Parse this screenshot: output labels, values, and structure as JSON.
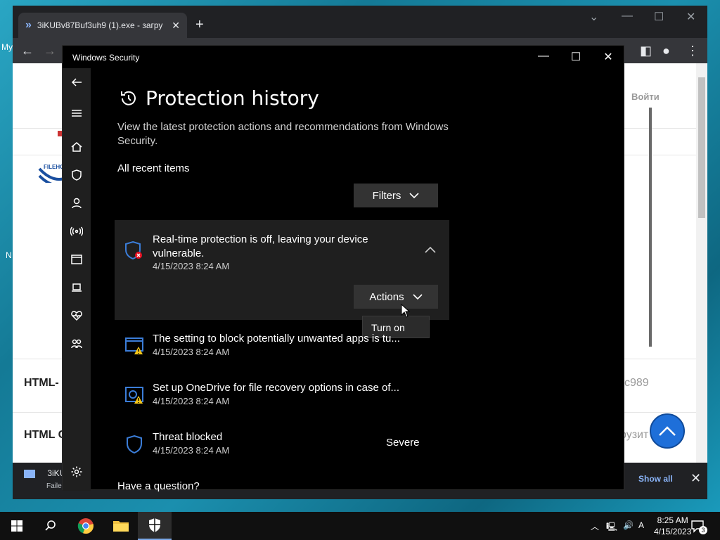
{
  "browser": {
    "tab_title": "3iKUBv87Buf3uh9 (1).exe - загру",
    "tab_close": "✕",
    "new_tab": "+",
    "page_texts": {
      "login": "Войти",
      "html_1": "HTML-",
      "html_2": "HTML C",
      "code_fragment": "c989",
      "loading_fragment": "рузит",
      "logo_text": "FILEHO"
    },
    "download": {
      "file_name": "3iKU",
      "status": "Faile",
      "show_all": "Show all"
    }
  },
  "desktop_fragments": [
    "My",
    "N"
  ],
  "window": {
    "title": "Windows Security",
    "minimize": "—",
    "maximize": "☐",
    "close": "✕"
  },
  "page": {
    "title": "Protection history",
    "description": "View the latest protection actions and recommendations from Windows Security.",
    "recent_label": "All recent items",
    "filters_label": "Filters",
    "question": "Have a question?"
  },
  "expanded_item": {
    "text": "Real-time protection is off, leaving your device vulnerable.",
    "date": "4/15/2023 8:24 AM",
    "actions_label": "Actions",
    "menu_item": "Turn on"
  },
  "items": [
    {
      "title": "The setting to block potentially unwanted apps is tu...",
      "date": "4/15/2023 8:24 AM",
      "severity": ""
    },
    {
      "title": "Set up OneDrive for file recovery options in case of...",
      "date": "4/15/2023 8:24 AM",
      "severity": ""
    },
    {
      "title": "Threat blocked",
      "date": "4/15/2023 8:24 AM",
      "severity": "Severe"
    }
  ],
  "taskbar": {
    "time": "8:25 AM",
    "date": "4/15/2023",
    "notification_count": "3"
  },
  "colors": {
    "accent": "#1e6fd9",
    "warning": "#f5c518",
    "error": "#e81123",
    "shield": "#3b7dd8"
  }
}
